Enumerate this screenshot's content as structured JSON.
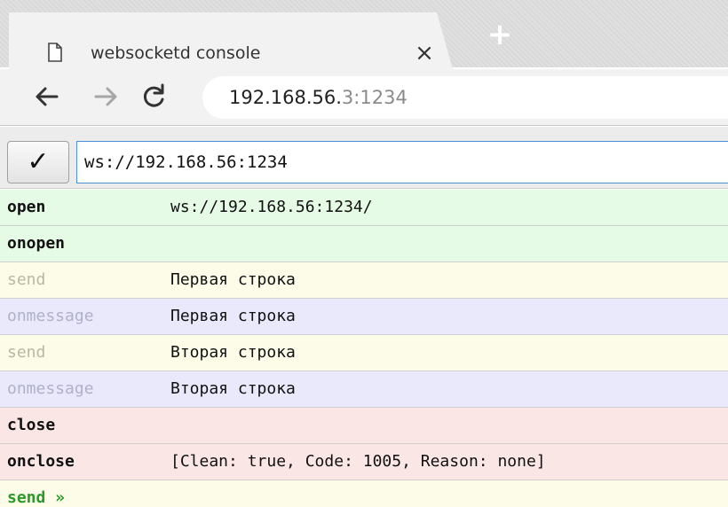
{
  "browser": {
    "tab_title": "websocketd console",
    "close_tab_glyph": "×",
    "new_tab_glyph": "+",
    "url_host": "192.168.56.",
    "url_rest": "3:1234"
  },
  "console": {
    "connect_button": "✓",
    "url_value": "ws://192.168.56:1234",
    "rows": [
      {
        "type": "open",
        "message": "ws://192.168.56:1234/"
      },
      {
        "type": "onopen",
        "message": ""
      },
      {
        "type": "send",
        "message": "Первая строка"
      },
      {
        "type": "onmessage",
        "message": "Первая строка"
      },
      {
        "type": "send",
        "message": "Вторая строка"
      },
      {
        "type": "onmessage",
        "message": "Вторая строка"
      },
      {
        "type": "close",
        "message": ""
      },
      {
        "type": "onclose",
        "message": "[Clean: true, Code: 1005, Reason: none]"
      }
    ],
    "input_label": "send »"
  },
  "icons": [
    "document-icon",
    "close-icon",
    "plus-icon",
    "back-arrow-icon",
    "forward-arrow-icon",
    "reload-icon",
    "checkmark-icon"
  ],
  "colors": {
    "open_bg": "#e6fbe6",
    "close_bg": "#fbe6e6",
    "send_bg": "#fcfce8",
    "onmessage_bg": "#e9e9fb",
    "send_prompt": "#2a9a2a",
    "input_border": "#4a90d9"
  }
}
